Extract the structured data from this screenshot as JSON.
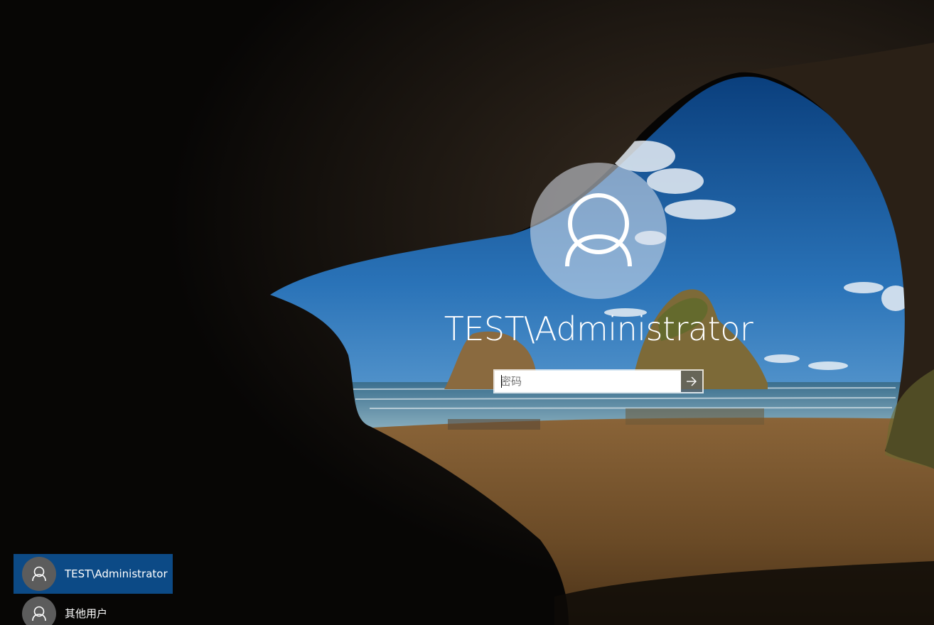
{
  "screen": "windows-lock-screen",
  "user": {
    "display_name": "TEST\\Administrator",
    "avatar": "person-icon"
  },
  "password": {
    "placeholder": "密码",
    "value": ""
  },
  "submit": {
    "icon": "arrow-right-icon"
  },
  "user_list": [
    {
      "label": "TEST\\Administrator",
      "selected": true,
      "icon": "person-icon"
    },
    {
      "label": "其他用户",
      "selected": false,
      "icon": "person-icon"
    }
  ],
  "colors": {
    "selected_tile": "#0c4a86",
    "sky": "#1f63a8",
    "sand": "#7a5530",
    "cave": "#0a0806"
  }
}
